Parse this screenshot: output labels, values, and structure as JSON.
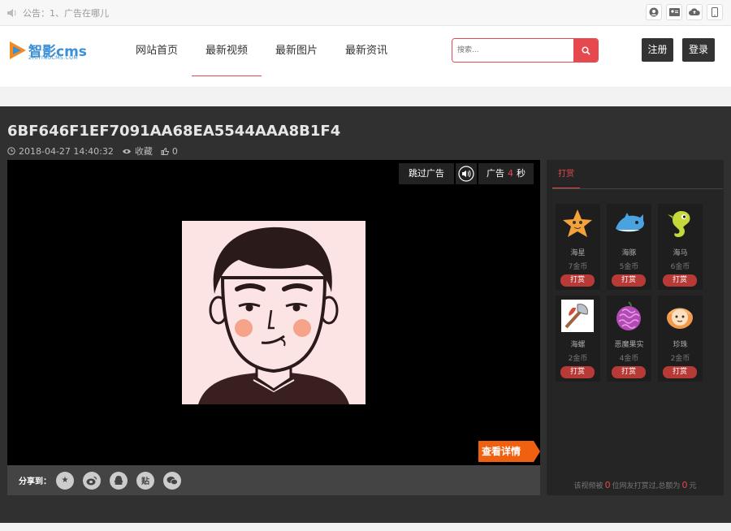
{
  "topbar": {
    "notice": "公告：1、广告在哪儿"
  },
  "header": {
    "logo_brand": "智影cms",
    "logo_sub": "ZHIYINGCMS.COM",
    "nav": [
      {
        "label": "网站首页"
      },
      {
        "label": "最新视频"
      },
      {
        "label": "最新图片"
      },
      {
        "label": "最新资讯"
      }
    ],
    "search_placeholder": "搜索...",
    "register_label": "注册",
    "login_label": "登录"
  },
  "video": {
    "title": "6BF646F1EF7091AA68EA5544AAA8B1F4",
    "datetime": "2018-04-27 14:40:32",
    "favorite_label": "收藏",
    "likes": "0",
    "skip_ad_label": "跳过广告",
    "ad_label": "广告",
    "ad_seconds": "4",
    "ad_unit": "秒",
    "detail_label": "查看详情",
    "share_label": "分享到："
  },
  "reward": {
    "tab_label": "打赏",
    "button_label": "打赏",
    "gifts": [
      {
        "name": "海星",
        "price": "7金币",
        "icon": "starfish-icon"
      },
      {
        "name": "海豚",
        "price": "5金币",
        "icon": "dolphin-icon"
      },
      {
        "name": "海马",
        "price": "6金币",
        "icon": "seahorse-icon"
      },
      {
        "name": "海螺",
        "price": "2金币",
        "icon": "conch-icon"
      },
      {
        "name": "恶魔果实",
        "price": "4金币",
        "icon": "devil-fruit-icon"
      },
      {
        "name": "珍珠",
        "price": "2金币",
        "icon": "pearl-icon"
      }
    ],
    "footer_prefix": "该视频被",
    "footer_count": "0",
    "footer_mid": "位网友打赏过,总额为",
    "footer_total": "0",
    "footer_unit": "元"
  },
  "colors": {
    "accent": "#e5484d",
    "detail_orange": "#ef6010",
    "reward_button": "#b73a37"
  }
}
